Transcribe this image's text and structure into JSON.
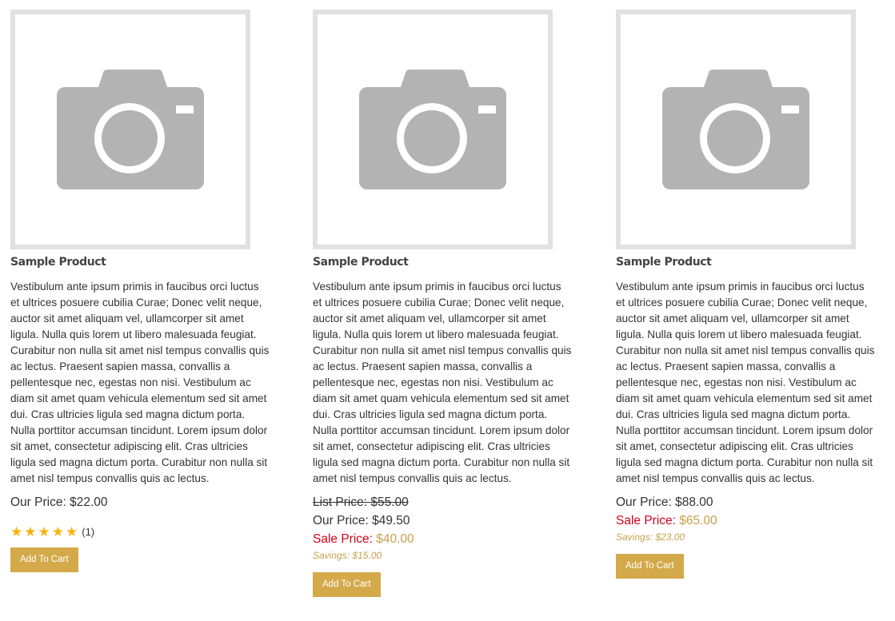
{
  "colors": {
    "placeholder_border": "#e1e1e1",
    "camera_gray": "#b3b3b3",
    "button_bg": "#d3a94a",
    "sale_label": "#d0021b",
    "gold_text": "#c9a14a",
    "star": "#f6b40e"
  },
  "icons": {
    "product_image": "camera-icon",
    "rating": "star-icon"
  },
  "products": [
    {
      "title": "Sample Product",
      "description": "Vestibulum ante ipsum primis in faucibus orci luctus et ultrices posuere cubilia Curae; Donec velit neque, auctor sit amet aliquam vel, ullamcorper sit amet ligula. Nulla quis lorem ut libero malesuada feugiat. Curabitur non nulla sit amet nisl tempus convallis quis ac lectus. Praesent sapien massa, convallis a pellentesque nec, egestas non nisi. Vestibulum ac diam sit amet quam vehicula elementum sed sit amet dui. Cras ultricies ligula sed magna dictum porta. Nulla porttitor accumsan tincidunt. Lorem ipsum dolor sit amet, consectetur adipiscing elit. Cras ultricies ligula sed magna dictum porta. Curabitur non nulla sit amet nisl tempus convallis quis ac lectus.",
      "our_price_label": "Our Price:",
      "our_price": "$22.00",
      "rating_stars": 5,
      "rating_count": "(1)",
      "button_label": "Add To Cart"
    },
    {
      "title": "Sample Product",
      "description": "Vestibulum ante ipsum primis in faucibus orci luctus et ultrices posuere cubilia Curae; Donec velit neque, auctor sit amet aliquam vel, ullamcorper sit amet ligula. Nulla quis lorem ut libero malesuada feugiat. Curabitur non nulla sit amet nisl tempus convallis quis ac lectus. Praesent sapien massa, convallis a pellentesque nec, egestas non nisi. Vestibulum ac diam sit amet quam vehicula elementum sed sit amet dui. Cras ultricies ligula sed magna dictum porta. Nulla porttitor accumsan tincidunt. Lorem ipsum dolor sit amet, consectetur adipiscing elit. Cras ultricies ligula sed magna dictum porta. Curabitur non nulla sit amet nisl tempus convallis quis ac lectus.",
      "list_price_text": "List Price: $55.00",
      "our_price_label": "Our Price:",
      "our_price": "$49.50",
      "sale_price_label": "Sale Price:",
      "sale_price": "$40.00",
      "savings": "Savings: $15.00",
      "button_label": "Add To Cart"
    },
    {
      "title": "Sample Product",
      "description": "Vestibulum ante ipsum primis in faucibus orci luctus et ultrices posuere cubilia Curae; Donec velit neque, auctor sit amet aliquam vel, ullamcorper sit amet ligula. Nulla quis lorem ut libero malesuada feugiat. Curabitur non nulla sit amet nisl tempus convallis quis ac lectus. Praesent sapien massa, convallis a pellentesque nec, egestas non nisi. Vestibulum ac diam sit amet quam vehicula elementum sed sit amet dui. Cras ultricies ligula sed magna dictum porta. Nulla porttitor accumsan tincidunt. Lorem ipsum dolor sit amet, consectetur adipiscing elit. Cras ultricies ligula sed magna dictum porta. Curabitur non nulla sit amet nisl tempus convallis quis ac lectus.",
      "our_price_label": "Our Price:",
      "our_price": "$88.00",
      "sale_price_label": "Sale Price:",
      "sale_price": "$65.00",
      "savings": "Savings: $23.00",
      "button_label": "Add To Cart"
    }
  ]
}
